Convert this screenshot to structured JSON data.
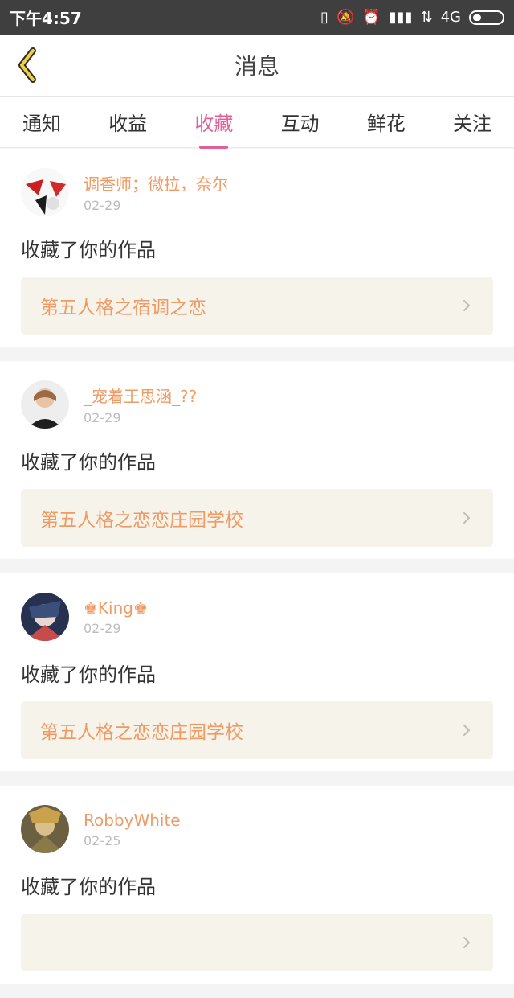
{
  "status": {
    "time": "下午4:57",
    "network": "4G"
  },
  "header": {
    "title": "消息"
  },
  "tabs": [
    {
      "label": "通知"
    },
    {
      "label": "收益"
    },
    {
      "label": "收藏",
      "active": true
    },
    {
      "label": "互动"
    },
    {
      "label": "鲜花"
    },
    {
      "label": "关注"
    }
  ],
  "items": [
    {
      "user": "调香师；微拉，奈尔",
      "date": "02-29",
      "action": "收藏了你的作品",
      "work_title": "第五人格之宿调之恋"
    },
    {
      "user": "_宠着王思涵_??",
      "date": "02-29",
      "action": "收藏了你的作品",
      "work_title": "第五人格之恋恋庄园学校"
    },
    {
      "user": "♚King♚",
      "date": "02-29",
      "action": "收藏了你的作品",
      "work_title": "第五人格之恋恋庄园学校"
    },
    {
      "user": "RobbyWhite",
      "date": "02-25",
      "action": "收藏了你的作品",
      "work_title": ""
    }
  ]
}
